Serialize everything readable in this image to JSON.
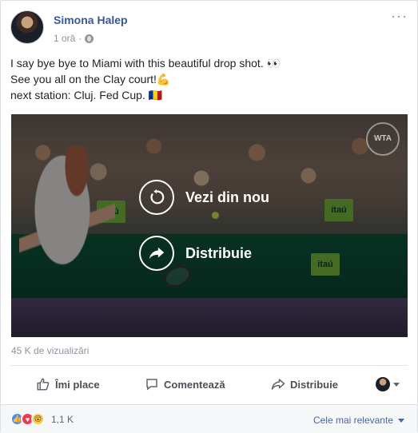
{
  "post": {
    "author": "Simona Halep",
    "time": "1 oră",
    "separator": "·",
    "more": "···",
    "lines": [
      "I say bye bye to Miami with this beautiful drop shot. 👀",
      "See you all on the Clay court!💪",
      "next station: Cluj. Fed Cup. 🇷🇴"
    ]
  },
  "video": {
    "replay_label": "Vezi din nou",
    "share_label": "Distribuie",
    "logo": "itaú",
    "wta": "WTA"
  },
  "stats": {
    "views": "45 K de vizualizări"
  },
  "actions": {
    "like": "Îmi place",
    "comment": "Comentează",
    "share": "Distribuie"
  },
  "footer": {
    "reaction_count": "1,1 K",
    "sort_label": "Cele mai relevante"
  },
  "icons": {
    "like": "thumbs-up-icon",
    "comment": "speech-bubble-icon",
    "share": "share-arrow-icon",
    "replay": "replay-icon",
    "globe": "globe-icon"
  },
  "colors": {
    "link": "#365899",
    "accent": "#4b67a1"
  }
}
